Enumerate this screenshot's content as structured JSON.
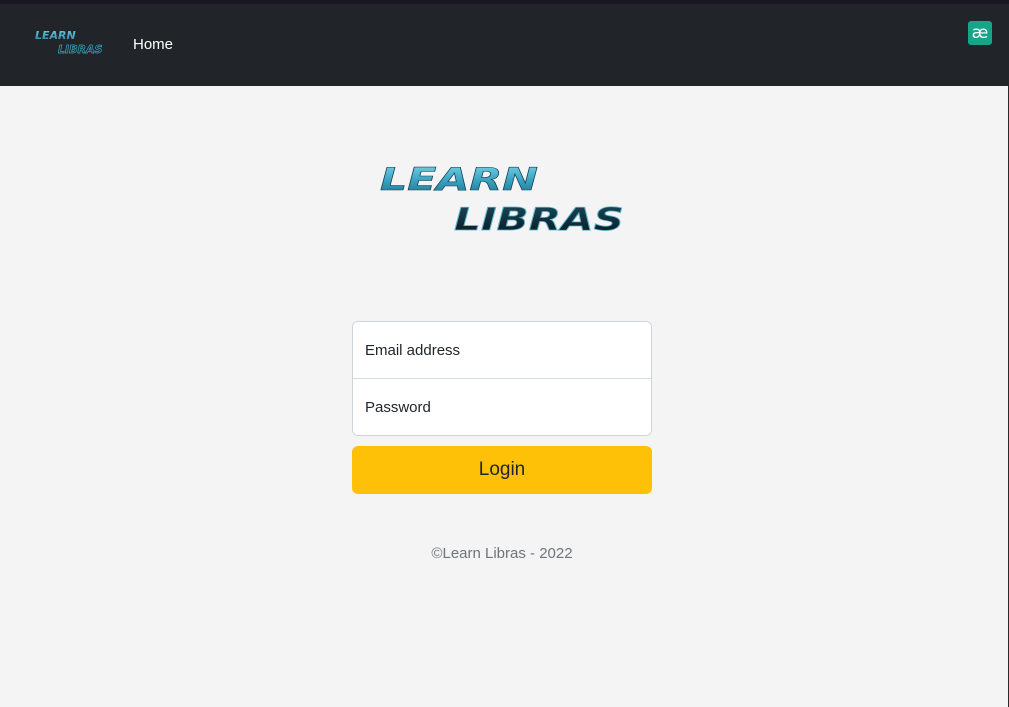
{
  "navbar": {
    "brand_name": "Learn Libras",
    "home_label": "Home",
    "extension_icon": "ae-icon",
    "extension_glyph": "æ"
  },
  "logo": {
    "line1": "LEARN",
    "line2": "LIBRAS"
  },
  "form": {
    "email_placeholder": "Email address",
    "password_placeholder": "Password",
    "submit_label": "Login"
  },
  "footer": {
    "copyright": "©Learn Libras - 2022"
  },
  "colors": {
    "navbar_bg": "#212529",
    "page_bg": "#f4f4f4",
    "button_bg": "#ffc107",
    "logo_teal": "#3aa3c1",
    "logo_dark": "#0c2a36"
  }
}
